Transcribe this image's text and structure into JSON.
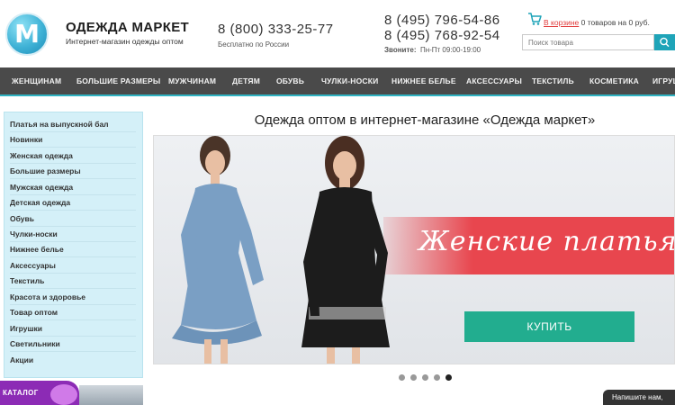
{
  "header": {
    "logo_letter": "M",
    "name": "ОДЕЖДА МАРКЕТ",
    "tagline": "Интернет-магазин одежды оптом",
    "phone_primary": "8 (800) 333-25-77",
    "phone_primary_note": "Бесплатно по России",
    "phone_secondary_1": "8 (495) 796-54-86",
    "phone_secondary_2": "8 (495) 768-92-54",
    "hours_label": "Звоните:",
    "hours_value": "Пн-Пт  09:00-19:00",
    "cart_link": "В корзине",
    "cart_summary": " 0 товаров на 0 руб.",
    "search_placeholder": "Поиск товара"
  },
  "nav": {
    "items": [
      "ЖЕНЩИНАМ",
      "БОЛЬШИЕ РАЗМЕРЫ",
      "МУЖЧИНАМ",
      "ДЕТЯМ",
      "ОБУВЬ",
      "ЧУЛКИ-НОСКИ",
      "НИЖНЕЕ БЕЛЬЕ",
      "АКСЕССУАРЫ",
      "ТЕКСТИЛЬ",
      "КОСМЕТИКА",
      "ИГРУШ"
    ]
  },
  "sidebar": {
    "items": [
      "Платья на выпускной бал",
      "Новинки",
      "Женская одежда",
      "Большие размеры",
      "Мужская одежда",
      "Детская одежда",
      "Обувь",
      "Чулки-носки",
      "Нижнее белье",
      "Аксессуары",
      "Текстиль",
      "Красота и здоровье",
      "Товар оптом",
      "Игрушки",
      "Светильники",
      "Акции"
    ],
    "catalog_label": "КАТАЛОГ"
  },
  "main": {
    "title": "Одежда оптом в интернет-магазине «Одежда маркет»",
    "banner_text": "Женские платья",
    "buy_label": "КУПИТЬ",
    "slides_total": 5,
    "slide_active": 5
  },
  "chat": {
    "label": "Напишите нам,"
  },
  "colors": {
    "accent": "#1fa4b8",
    "nav_bg": "#4a4a4a",
    "banner_red": "#e8464e",
    "buy_green": "#22ad8f",
    "sidebar_bg": "#d4f0f8",
    "catalog_purple": "#8c2bb5"
  },
  "icons": {
    "cart": "cart-icon",
    "search": "search-icon",
    "catalog": "catalog-icon"
  }
}
